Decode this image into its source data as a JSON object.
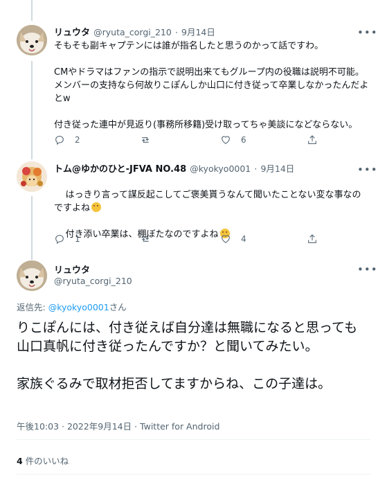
{
  "tweets": [
    {
      "name": "リュウタ",
      "handle": "@ryuta_corgi_210",
      "sep": "·",
      "date": "9月14日",
      "text": "そもそも副キャプテンには誰が指名したと思うのかって話ですわ。\n\nCMやドラマはファンの指示で説明出来てもグループ内の役職は説明不可能。メンバーの支持なら何故りこぽんしか山口に付き従って卒業しなかったんだよとw\n\n付き従った連中が見返り(事務所移籍)受け取ってちゃ美談になどならない。",
      "replies": "2",
      "retweets": "",
      "likes": "6"
    },
    {
      "name": "トム@ゆかのひと-JFVA NO.48",
      "handle": "@kyokyo0001",
      "sep": "·",
      "date": "9月14日",
      "text_line1": "はっきり言って謀反起こしてご褒美貰うなんて聞いたことない変な事なのですよね",
      "text_line2": "付き添い卒業は、棚ぼたなのですよね",
      "replies": "1",
      "retweets": "",
      "likes": "4"
    }
  ],
  "main": {
    "name": "リュウタ",
    "handle": "@ryuta_corgi_210",
    "reply_to_prefix": "返信先: ",
    "reply_to_handle": "@kyokyo0001",
    "reply_to_suffix": "さん",
    "text": "りこぽんには、付き従えば自分達は無職になると思っても山口真帆に付き従ったんですか？と聞いてみたい。\n\n家族ぐるみで取材拒否してますからね、この子達は。",
    "timestamp": "午後10:03 · 2022年9月14日 · Twitter for Android",
    "likes_count": "4",
    "likes_label": " 件のいいね"
  },
  "icons": [
    "reply-icon",
    "retweet-icon",
    "like-icon",
    "share-icon",
    "more-icon",
    "thinking-emoji"
  ],
  "colors": {
    "text": "#0f1419",
    "secondary": "#536471",
    "link": "#1d9bf0",
    "divider": "#eff3f4",
    "thread": "#cfd9de"
  }
}
